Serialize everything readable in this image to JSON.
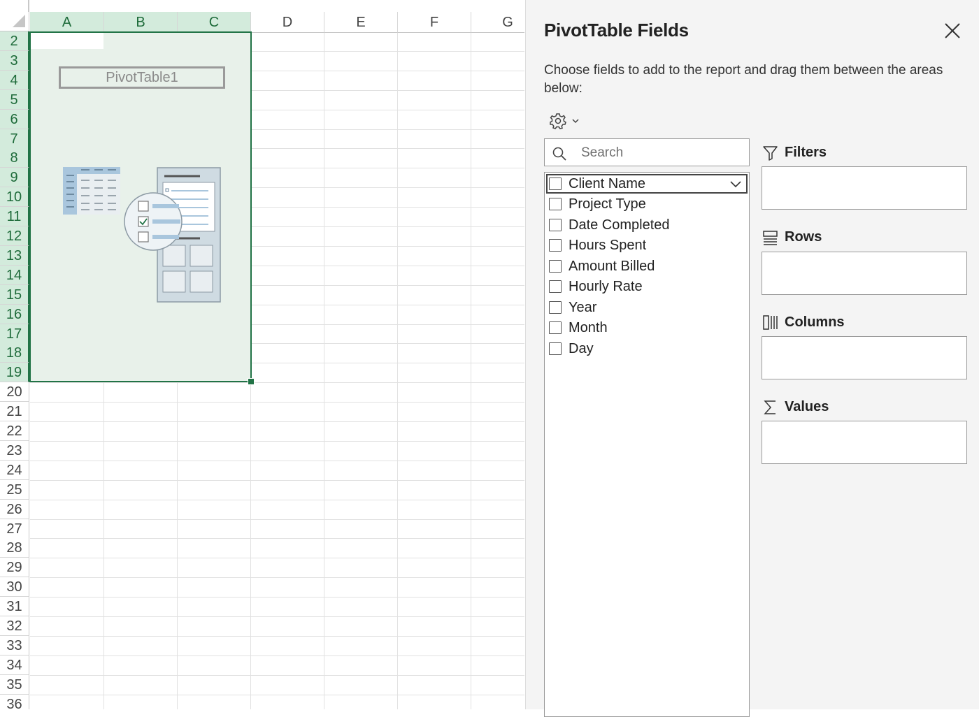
{
  "sheet": {
    "columns": [
      "A",
      "B",
      "C",
      "D",
      "E",
      "F",
      "G"
    ],
    "rows": [
      "2",
      "3",
      "4",
      "5",
      "6",
      "7",
      "8",
      "9",
      "10",
      "11",
      "12",
      "13",
      "14",
      "15",
      "16",
      "17",
      "18",
      "19",
      "20",
      "21",
      "22",
      "23",
      "24",
      "25",
      "26",
      "27",
      "28",
      "29",
      "30",
      "31",
      "32",
      "33",
      "34",
      "35",
      "36"
    ],
    "selected_columns": [
      "A",
      "B",
      "C"
    ],
    "selected_rows_range": [
      "2",
      "19"
    ],
    "pivot_name": "PivotTable1",
    "accent_color": "#217346"
  },
  "pane": {
    "title": "PivotTable Fields",
    "description": "Choose fields to add to the report and drag them between the areas below:",
    "search_placeholder": "Search",
    "fields": [
      {
        "label": "Client Name",
        "checked": false
      },
      {
        "label": "Project Type",
        "checked": false
      },
      {
        "label": "Date Completed",
        "checked": false
      },
      {
        "label": "Hours Spent",
        "checked": false
      },
      {
        "label": "Amount Billed",
        "checked": false
      },
      {
        "label": "Hourly Rate",
        "checked": false
      },
      {
        "label": "Year",
        "checked": false
      },
      {
        "label": "Month",
        "checked": false
      },
      {
        "label": "Day",
        "checked": false
      }
    ],
    "areas": {
      "filters": "Filters",
      "rows": "Rows",
      "columns": "Columns",
      "values": "Values"
    },
    "icons": {
      "close": "close-icon",
      "settings": "gear-icon",
      "search": "search-icon",
      "filters": "filter-icon",
      "rows": "rows-icon",
      "columns": "columns-icon",
      "values": "sigma-icon"
    }
  }
}
